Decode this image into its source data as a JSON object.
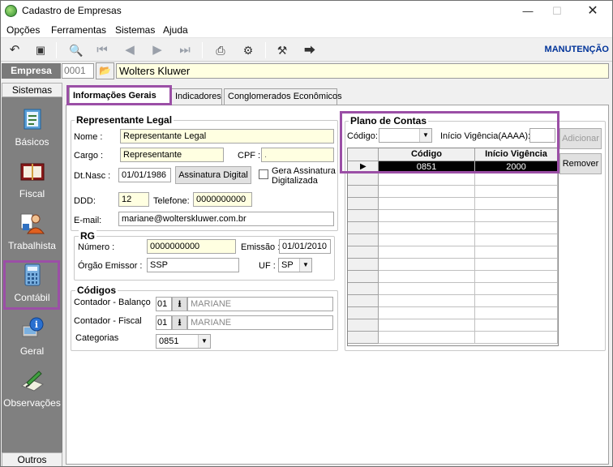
{
  "window": {
    "title": "Cadastro de Empresas"
  },
  "menu": [
    "Opções",
    "Ferramentas",
    "Sistemas",
    "Ajuda"
  ],
  "toolbar": {
    "mode_label": "MANUTENÇÃO"
  },
  "empresa": {
    "label": "Empresa",
    "code": "0001",
    "name": "Wolters Kluwer"
  },
  "sidebar": {
    "header": "Sistemas",
    "footer": "Outros",
    "items": [
      {
        "label": "Básicos",
        "icon": "notebook-icon"
      },
      {
        "label": "Fiscal",
        "icon": "ledger-book-icon"
      },
      {
        "label": "Trabalhista",
        "icon": "worker-icon"
      },
      {
        "label": "Contábil",
        "icon": "calculator-icon"
      },
      {
        "label": "Geral",
        "icon": "info-computer-icon"
      },
      {
        "label": "Observações",
        "icon": "notepad-pen-icon"
      }
    ]
  },
  "tabs": [
    "Informações Gerais",
    "Indicadores",
    "Conglomerados Econômicos"
  ],
  "rep": {
    "title": "Representante Legal",
    "nome_label": "Nome :",
    "nome": "Representante Legal",
    "cargo_label": "Cargo :",
    "cargo": "Representante",
    "cpf_label": "CPF :",
    "cpf": ".",
    "dtnasc_label": "Dt.Nasc :",
    "dtnasc": "01/01/1986",
    "assinatura_btn": "Assinatura Digital",
    "gera_label_1": "Gera Assinatura",
    "gera_label_2": "Digitalizada",
    "ddd_label": "DDD:",
    "ddd": "12",
    "tel_label": "Telefone:",
    "tel": "0000000000",
    "email_label": "E-mail:",
    "email": "mariane@wolterskluwer.com.br"
  },
  "rg": {
    "title": "RG",
    "numero_label": "Número :",
    "numero": "0000000000",
    "emissao_label": "Emissão :",
    "emissao": "01/01/2010",
    "orgao_label": "Órgão Emissor :",
    "orgao": "SSP",
    "uf_label": "UF :",
    "uf": "SP"
  },
  "codigos": {
    "title": "Códigos",
    "balanco_label": "Contador - Balanço",
    "balanco_code": "01",
    "balanco_name": "MARIANE",
    "fiscal_label": "Contador - Fiscal",
    "fiscal_code": "01",
    "fiscal_name": "MARIANE",
    "categorias_label": "Categorias",
    "categorias": "0851"
  },
  "plano": {
    "title": "Plano de Contas",
    "codigo_label": "Código:",
    "inicio_label": "Início Vigência(AAAA):",
    "adicionar": "Adicionar",
    "remover": "Remover",
    "col_codigo": "Código",
    "col_inicio": "Início Vigência",
    "rows": [
      {
        "codigo": "0851",
        "inicio": "2000"
      }
    ]
  }
}
